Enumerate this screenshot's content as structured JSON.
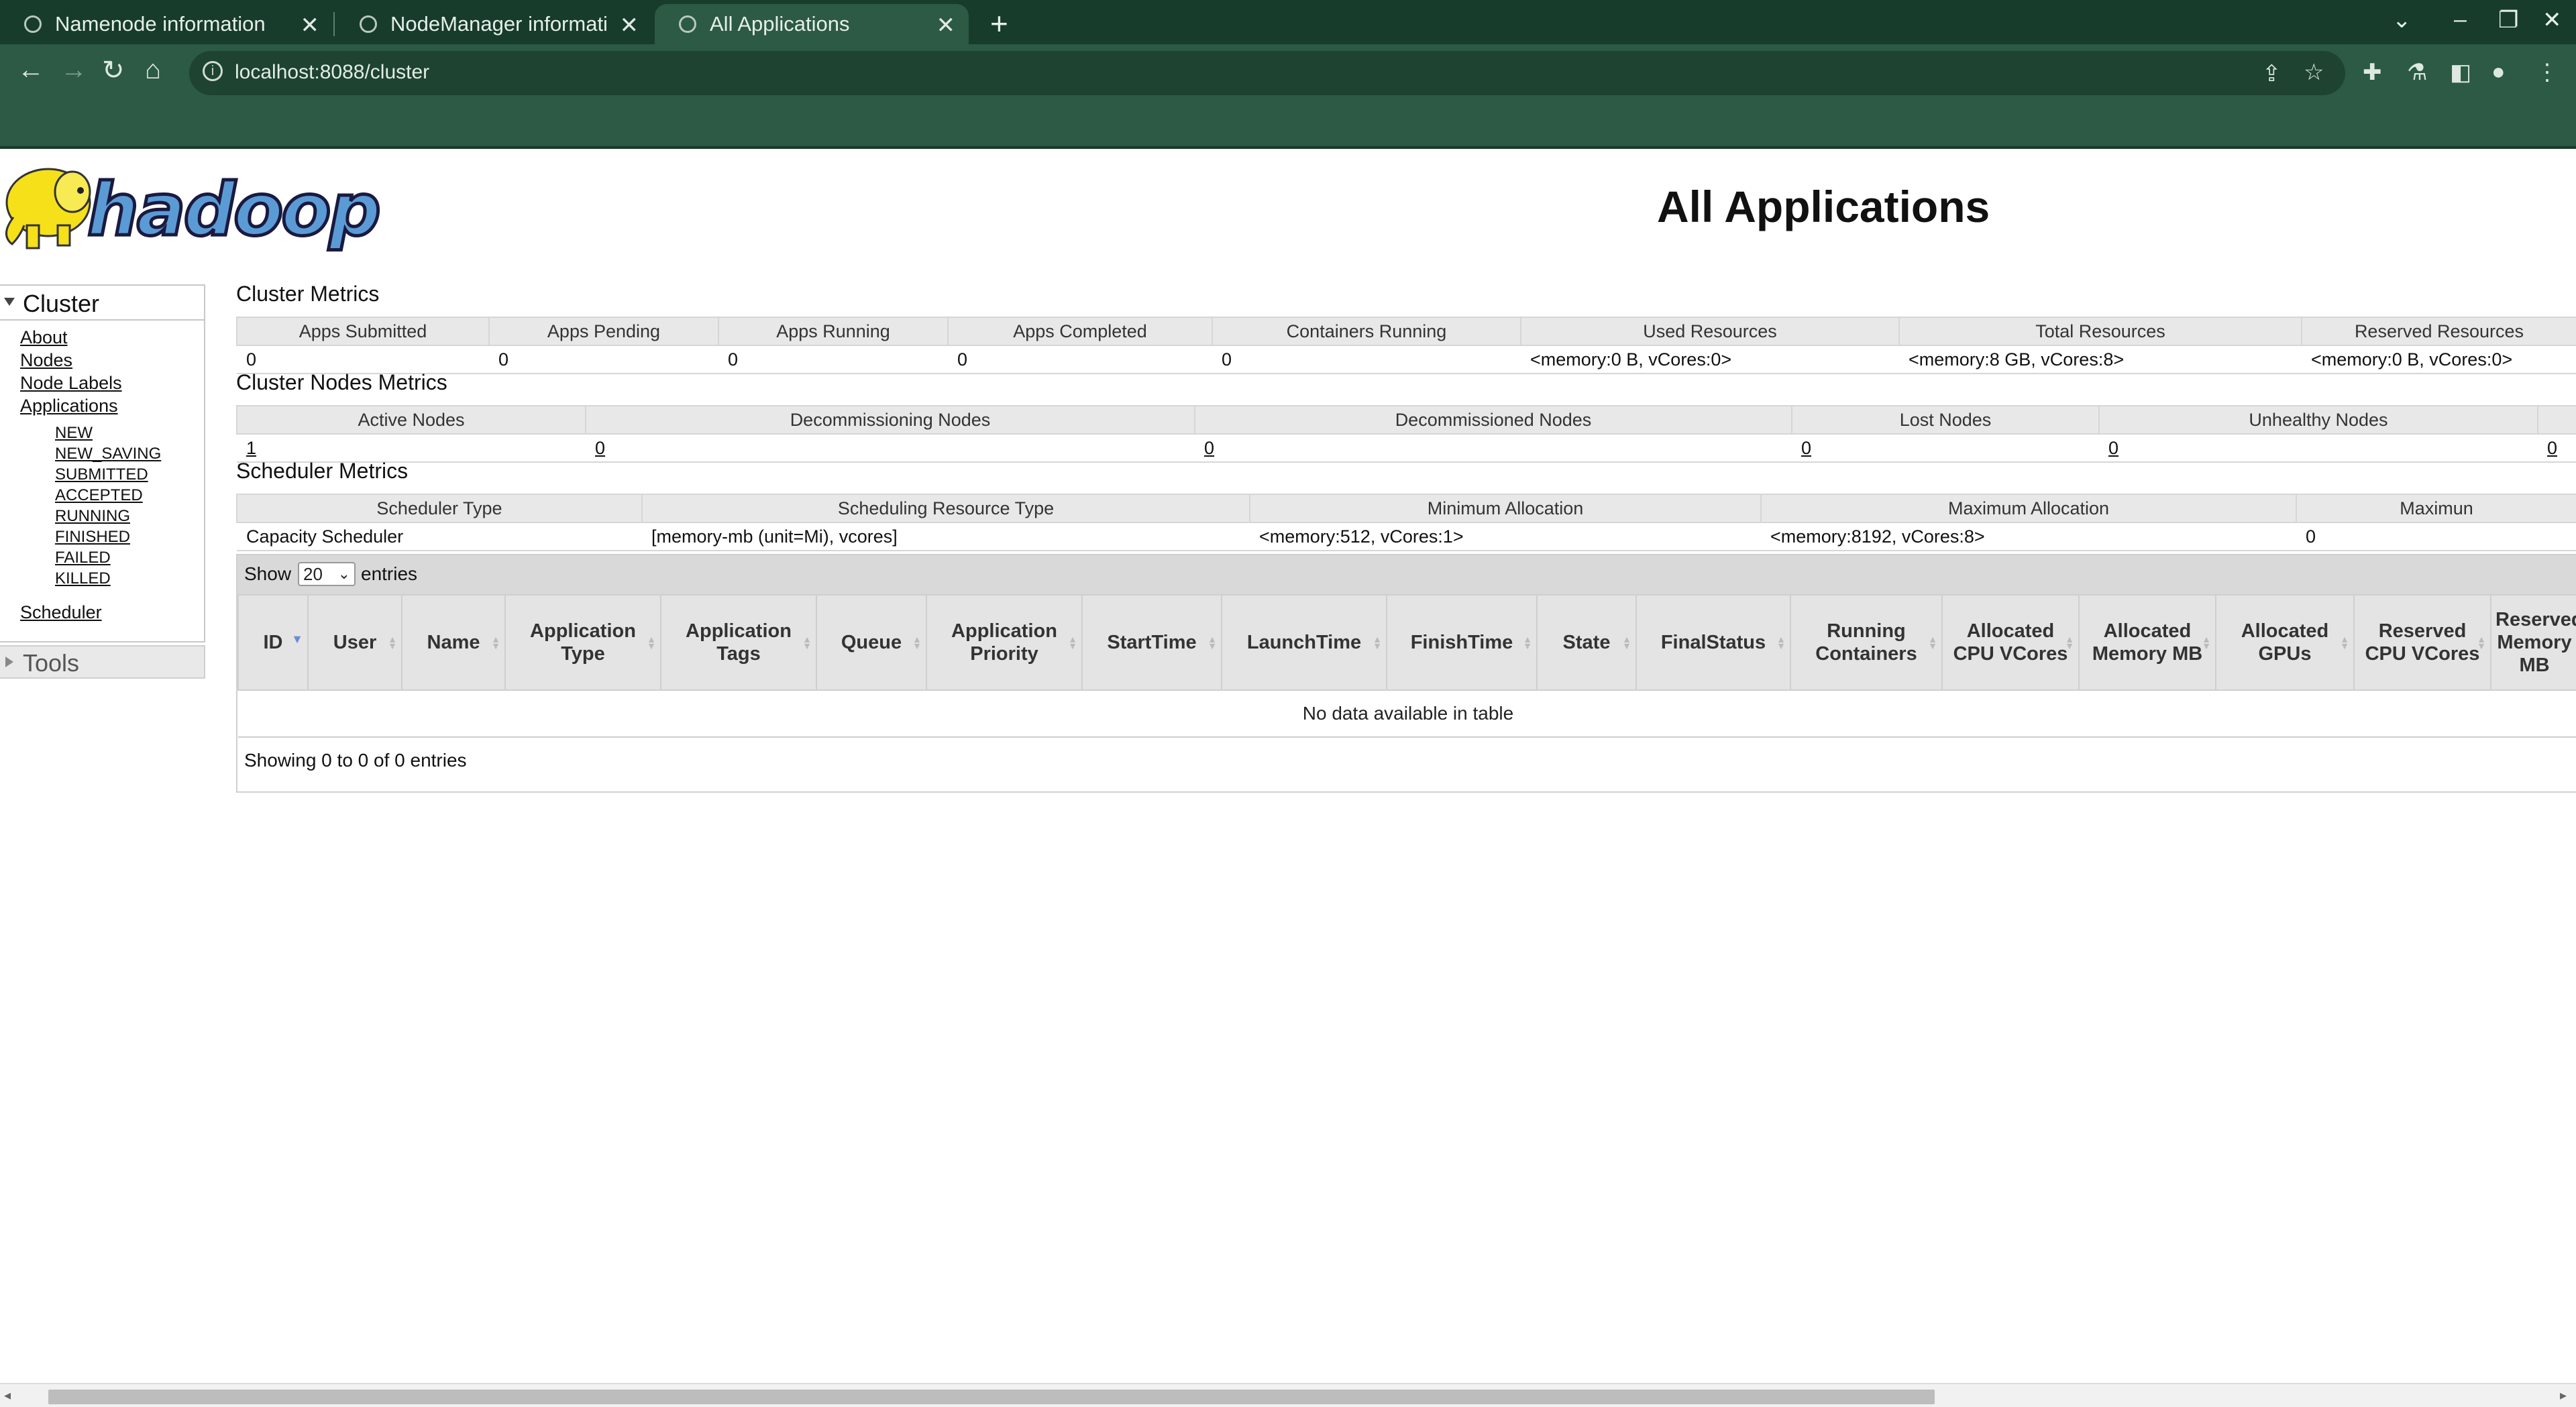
{
  "browser": {
    "tabs": [
      {
        "label": "Namenode information"
      },
      {
        "label": "NodeManager informati"
      },
      {
        "label": "All Applications"
      }
    ],
    "url": "localhost:8088/cluster"
  },
  "page": {
    "title": "All Applications"
  },
  "sidebar": {
    "cluster_label": "Cluster",
    "links": [
      "About",
      "Nodes",
      "Node Labels",
      "Applications"
    ],
    "app_states": [
      "NEW",
      "NEW_SAVING",
      "SUBMITTED",
      "ACCEPTED",
      "RUNNING",
      "FINISHED",
      "FAILED",
      "KILLED"
    ],
    "scheduler_label": "Scheduler",
    "tools_label": "Tools"
  },
  "cluster_metrics": {
    "title": "Cluster Metrics",
    "headers": [
      "Apps Submitted",
      "Apps Pending",
      "Apps Running",
      "Apps Completed",
      "Containers Running",
      "Used Resources",
      "Total Resources",
      "Reserved Resources"
    ],
    "values": [
      "0",
      "0",
      "0",
      "0",
      "0",
      "<memory:0 B, vCores:0>",
      "<memory:8 GB, vCores:8>",
      "<memory:0 B, vCores:0>"
    ]
  },
  "nodes_metrics": {
    "title": "Cluster Nodes Metrics",
    "headers": [
      "Active Nodes",
      "Decommissioning Nodes",
      "Decommissioned Nodes",
      "Lost Nodes",
      "Unhealthy Nodes",
      ""
    ],
    "values": [
      "1",
      "0",
      "0",
      "0",
      "0",
      "0"
    ]
  },
  "scheduler_metrics": {
    "title": "Scheduler Metrics",
    "headers": [
      "Scheduler Type",
      "Scheduling Resource Type",
      "Minimum Allocation",
      "Maximum Allocation",
      "Maximun"
    ],
    "values": [
      "Capacity Scheduler",
      "[memory-mb (unit=Mi), vcores]",
      "<memory:512, vCores:1>",
      "<memory:8192, vCores:8>",
      "0"
    ]
  },
  "apps_table": {
    "show_label": "Show",
    "page_size": "20",
    "entries_label": "entries",
    "columns": [
      "ID",
      "User",
      "Name",
      "Application Type",
      "Application Tags",
      "Queue",
      "Application Priority",
      "StartTime",
      "LaunchTime",
      "FinishTime",
      "State",
      "FinalStatus",
      "Running Containers",
      "Allocated CPU VCores",
      "Allocated Memory MB",
      "Allocated GPUs",
      "Reserved CPU VCores",
      "Reserved Memory MB"
    ],
    "empty_message": "No data available in table",
    "info": "Showing 0 to 0 of 0 entries"
  }
}
